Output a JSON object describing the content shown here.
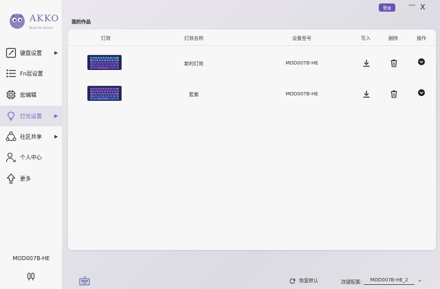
{
  "app": {
    "brand": "AKKO",
    "tagline": "Touch the fashion",
    "login_label": "登录",
    "minimize_glyph": "—",
    "close_glyph": "X"
  },
  "sidebar": {
    "items": [
      {
        "label": "键盘设置",
        "icon": "keyboard-settings-icon",
        "has_arrow": true,
        "active": false
      },
      {
        "label": "Fn层设置",
        "icon": "list-icon",
        "has_arrow": false,
        "active": false
      },
      {
        "label": "宏编辑",
        "icon": "chip-icon",
        "has_arrow": false,
        "active": false
      },
      {
        "label": "灯光设置",
        "icon": "bulb-icon",
        "has_arrow": true,
        "active": true
      },
      {
        "label": "社区共享",
        "icon": "share-icon",
        "has_arrow": true,
        "active": false
      },
      {
        "label": "个人中心",
        "icon": "user-icon",
        "has_arrow": false,
        "active": false
      },
      {
        "label": "更多",
        "icon": "upload-icon",
        "has_arrow": false,
        "active": false
      }
    ],
    "arrow_glyph": "▶",
    "model_name": "MOD007B-HE"
  },
  "main": {
    "section_title": "我的作品",
    "table": {
      "headers": [
        "灯效",
        "灯效名称",
        "设备型号",
        "写入",
        "删除",
        "操作"
      ],
      "rows": [
        {
          "name": "新的灯效",
          "model": "MOD007B-HE",
          "preview": "purple-blue"
        },
        {
          "name": "藍紫",
          "model": "MOD007B-HE",
          "preview": "purple"
        }
      ]
    }
  },
  "footer": {
    "restore_label": "恢复默认",
    "config_label": "改键配置:",
    "config_value": "MOD007B-HE_2"
  },
  "colors": {
    "accent": "#6b54b0",
    "active_text": "#7a62c9",
    "keyboard_body": "#23284a",
    "key_blue": "#5b8fe0",
    "key_purple": "#7a4fd0"
  }
}
